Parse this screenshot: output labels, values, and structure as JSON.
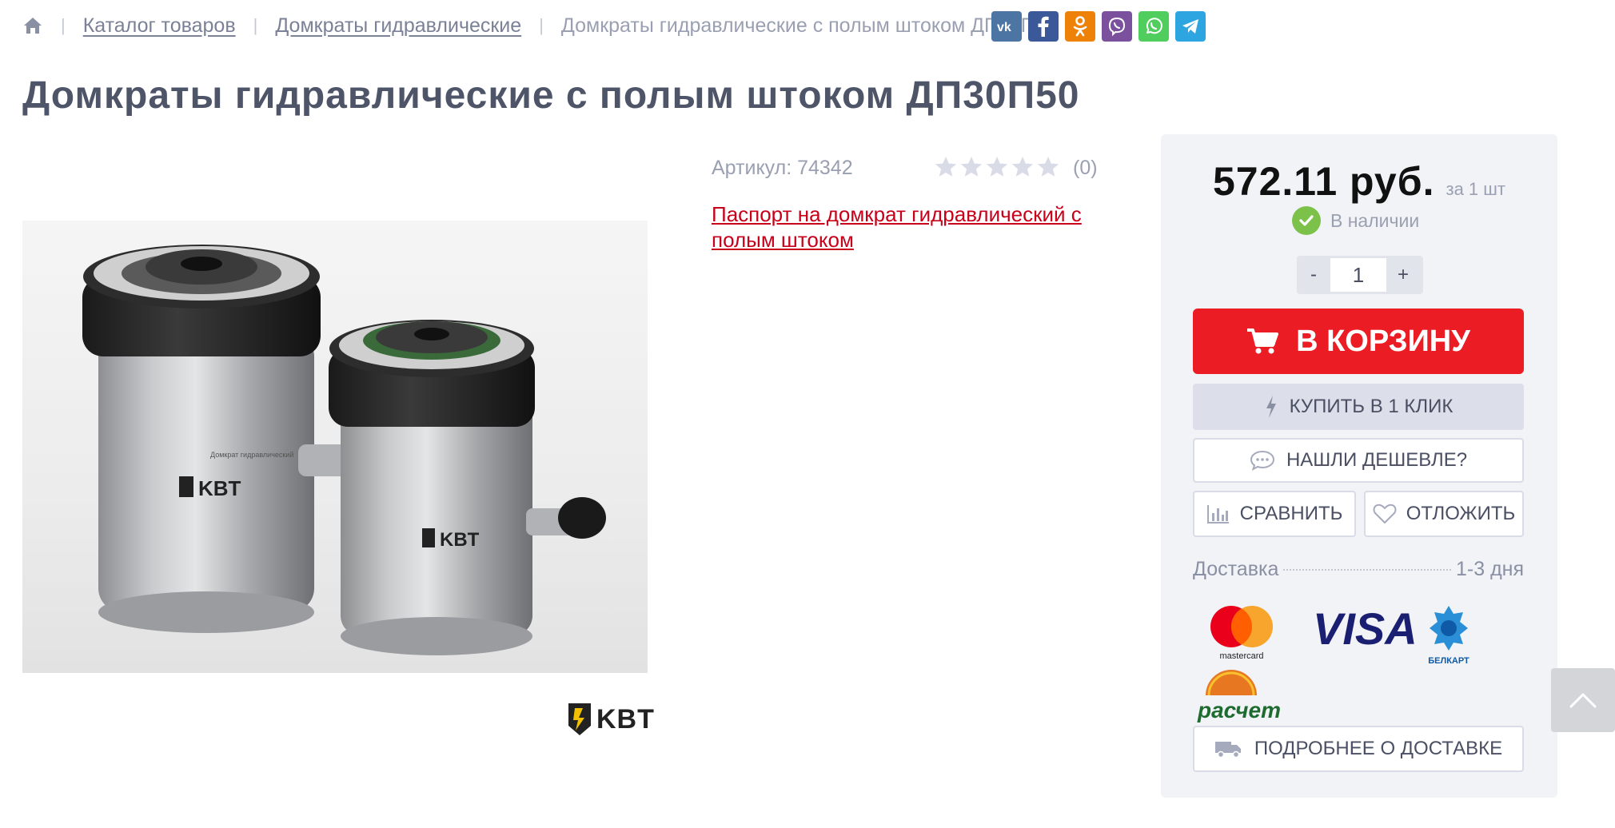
{
  "breadcrumb": {
    "home_icon": "home-icon",
    "items": [
      "Каталог товаров",
      "Домкраты гидравлические"
    ],
    "current": "Домкраты гидравлические с полым штоком ДП30П50"
  },
  "social": [
    "vk",
    "facebook",
    "odnoklassniki",
    "viber",
    "whatsapp",
    "telegram"
  ],
  "social_colors": [
    "#4c75a3",
    "#3b5998",
    "#ee8208",
    "#7b519d",
    "#4fce5d",
    "#2ca5e0"
  ],
  "product": {
    "title": "Домкраты гидравлические с полым штоком ДП30П50",
    "sku": "Артикул: 74342",
    "rating": 0,
    "reviews": "(0)",
    "passport_link": "Паспорт на домкрат гидравлический с полым штоком",
    "brand": "KBT",
    "photo_label": "Домкрат гидравлический"
  },
  "buy": {
    "price": "572.11 руб.",
    "per_unit": "за 1 шт",
    "stock": "В наличии",
    "qty_minus": "-",
    "qty_value": "1",
    "qty_plus": "+",
    "cart_label": "В КОРЗИНУ",
    "one_click_label": "КУПИТЬ В 1 КЛИК",
    "cheaper_label": "НАШЛИ ДЕШЕВЛЕ?",
    "compare_label": "СРАВНИТЬ",
    "later_label": "ОТЛОЖИТЬ",
    "delivery_label": "Доставка",
    "delivery_value": "1-3 дня",
    "more_delivery_label": "ПОДРОБНЕЕ О ДОСТАВКЕ"
  },
  "payments": {
    "mastercard": "mastercard",
    "visa": "VISA",
    "belkart": "БЕЛКАРТ",
    "raschet": "расчет"
  },
  "colors": {
    "accent": "#ec1c24",
    "link": "#c8001a",
    "text": "#4f5568",
    "stock": "#7cc24a"
  }
}
